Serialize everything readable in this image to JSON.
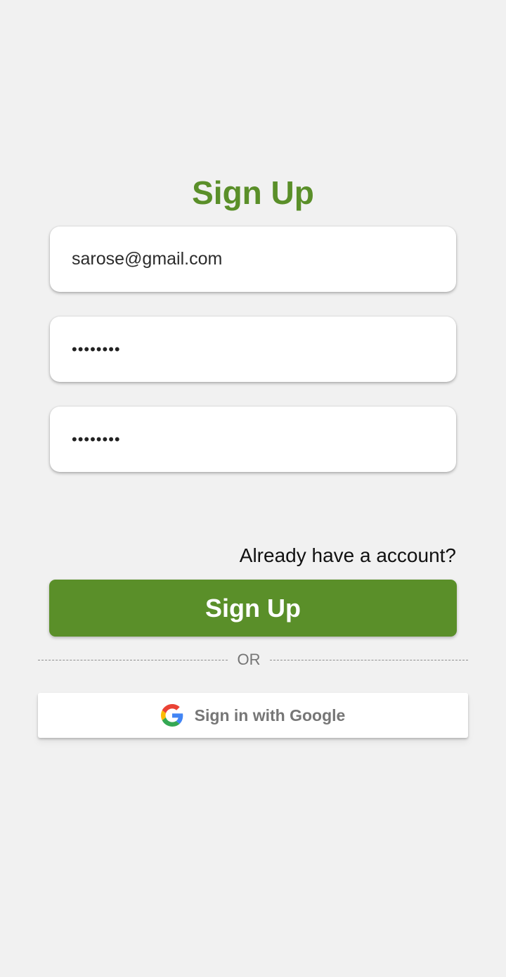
{
  "page": {
    "title": "Sign Up"
  },
  "form": {
    "email_value": "sarose@gmail.com",
    "password_value": "password",
    "confirm_password_value": "password"
  },
  "links": {
    "already_have_account": "Already have a account?"
  },
  "buttons": {
    "sign_up_label": "Sign Up",
    "google_label": "Sign in with Google",
    "google_icon": "google-g-icon"
  },
  "divider": {
    "text": "OR"
  },
  "colors": {
    "brand_green": "#5a8f29",
    "background": "#f1f1f1",
    "google_blue": "#4285F4",
    "google_red": "#EA4335",
    "google_yellow": "#FBBC05",
    "google_green": "#34A853"
  }
}
